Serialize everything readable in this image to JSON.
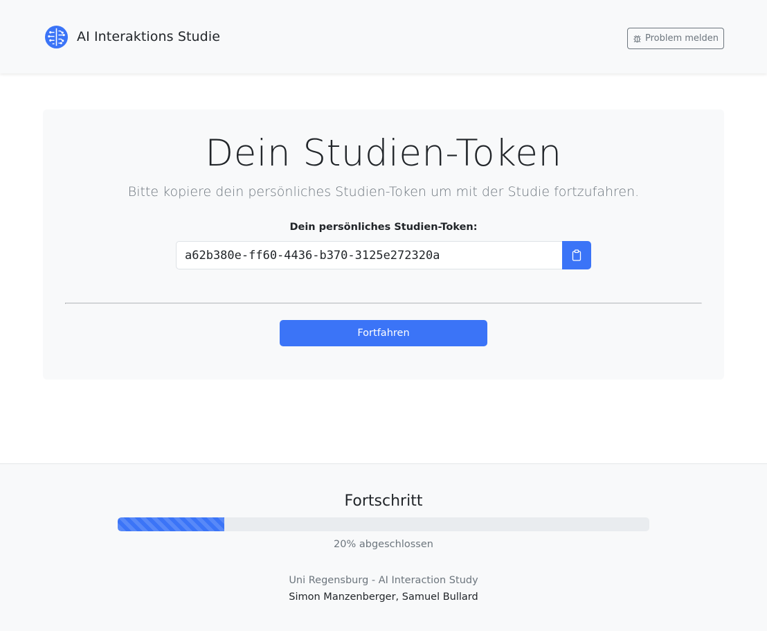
{
  "header": {
    "brand_icon": "brain-icon",
    "brand_title": "AI Interaktions Studie",
    "report_icon": "bug-icon",
    "report_label": "Problem melden"
  },
  "main": {
    "title": "Dein Studien-Token",
    "subtitle": "Bitte kopiere dein persönliches Studien-Token um mit der Studie fortzufahren.",
    "token_label": "Dein persönliches Studien-Token:",
    "token_value": "a62b380e-ff60-4436-b370-3125e272320a",
    "copy_icon": "clipboard-icon",
    "continue_label": "Fortfahren"
  },
  "footer": {
    "progress_title": "Fortschritt",
    "progress_percent": 20,
    "progress_text": "20% abgeschlossen",
    "institution": "Uni Regensburg - AI Interaction Study",
    "authors": "Simon Manzenberger, Samuel Bullard"
  },
  "colors": {
    "primary": "#3b74f7",
    "muted_text": "#6c757d",
    "light_bg": "#f8f9fa"
  }
}
